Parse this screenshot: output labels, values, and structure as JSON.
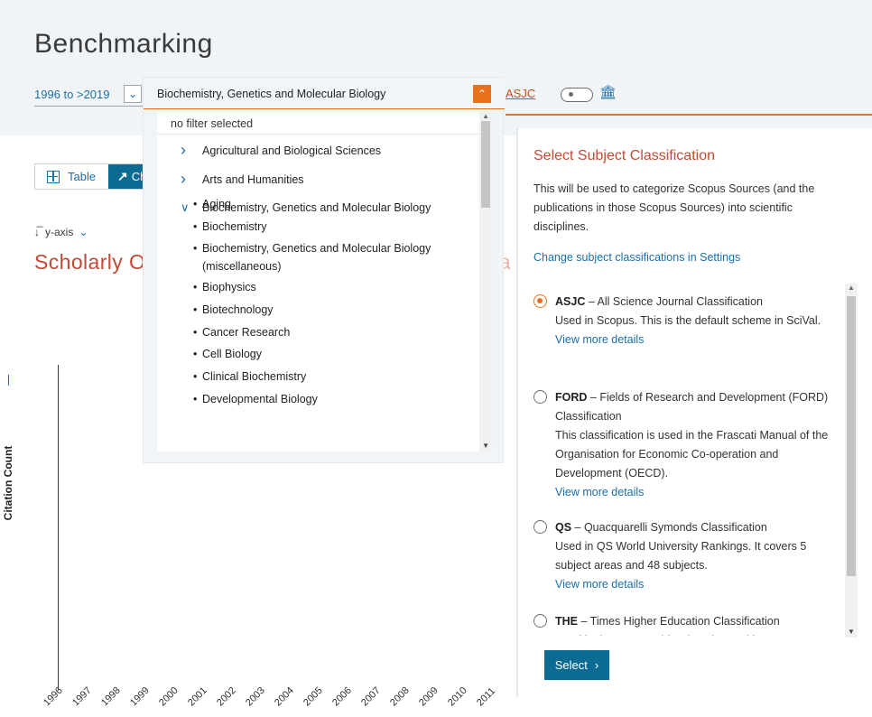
{
  "page": {
    "title": "Benchmarking"
  },
  "toolbar": {
    "year_range": "1996 to >2019",
    "subject_value": "Biochemistry, Genetics and Molecular Biology",
    "classification": "ASJC"
  },
  "view": {
    "table_label": "Table",
    "chart_label": "Ch"
  },
  "yaxis": {
    "label": "y-axis"
  },
  "chart": {
    "title_visible": "Scholarly Ou",
    "title_tail": "ea",
    "y_axis_label": "Citation Count"
  },
  "chart_data": {
    "type": "line",
    "title": "",
    "ylabel": "Citation Count",
    "x": [
      "1996",
      "1997",
      "1998",
      "1999",
      "2000",
      "2001",
      "2002",
      "2003",
      "2004",
      "2005",
      "2006",
      "2007",
      "2008",
      "2009",
      "2010",
      "2011"
    ],
    "series": []
  },
  "dropdown": {
    "filter_text": "no filter selected",
    "categories": [
      {
        "label": "Agricultural and Biological Sciences",
        "expanded": false
      },
      {
        "label": "Arts and Humanities",
        "expanded": false
      },
      {
        "label": "Biochemistry, Genetics and Molecular Biology",
        "expanded": true
      }
    ],
    "subitems": [
      "Aging",
      "Biochemistry",
      "Biochemistry, Genetics and Molecular Biology (miscellaneous)",
      "Biophysics",
      "Biotechnology",
      "Cancer Research",
      "Cell Biology",
      "Clinical Biochemistry",
      "Developmental Biology"
    ]
  },
  "panel": {
    "title": "Select Subject Classification",
    "description": "This will be used to categorize Scopus Sources (and the publications in those Scopus Sources) into scientific disciplines.",
    "settings_link": "Change subject classifications in Settings",
    "options": [
      {
        "code": "ASJC",
        "name": " – All Science Journal Classification",
        "detail": "Used in Scopus. This is the default scheme in SciVal.",
        "more": "View more details",
        "selected": true
      },
      {
        "code": "FORD",
        "name": " – Fields of Research and Development (FORD) Classification",
        "detail": "This classification is used in the Frascati Manual of the Organisation for Economic Co-operation and Development (OECD).",
        "more": "View more details",
        "selected": false
      },
      {
        "code": "QS",
        "name": " – Quacquarelli Symonds Classification",
        "detail": "Used in QS World University Rankings. It covers 5 subject areas and 48 subjects.",
        "more": "View more details",
        "selected": false
      },
      {
        "code": "THE",
        "name": " – Times Higher Education Classification",
        "detail": "Used in the THE World University Rankings.",
        "more": "View more details",
        "selected": false
      }
    ],
    "select_label": "Select"
  }
}
